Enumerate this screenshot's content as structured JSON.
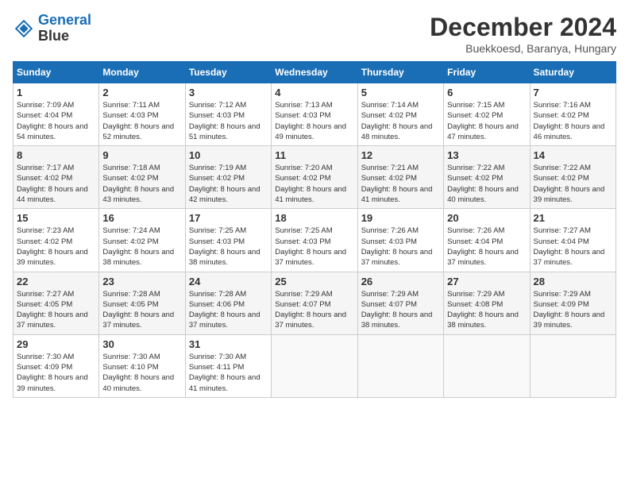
{
  "header": {
    "logo_line1": "General",
    "logo_line2": "Blue",
    "month_title": "December 2024",
    "location": "Buekkoesd, Baranya, Hungary"
  },
  "weekdays": [
    "Sunday",
    "Monday",
    "Tuesday",
    "Wednesday",
    "Thursday",
    "Friday",
    "Saturday"
  ],
  "weeks": [
    [
      {
        "day": "1",
        "sunrise": "Sunrise: 7:09 AM",
        "sunset": "Sunset: 4:04 PM",
        "daylight": "Daylight: 8 hours and 54 minutes."
      },
      {
        "day": "2",
        "sunrise": "Sunrise: 7:11 AM",
        "sunset": "Sunset: 4:03 PM",
        "daylight": "Daylight: 8 hours and 52 minutes."
      },
      {
        "day": "3",
        "sunrise": "Sunrise: 7:12 AM",
        "sunset": "Sunset: 4:03 PM",
        "daylight": "Daylight: 8 hours and 51 minutes."
      },
      {
        "day": "4",
        "sunrise": "Sunrise: 7:13 AM",
        "sunset": "Sunset: 4:03 PM",
        "daylight": "Daylight: 8 hours and 49 minutes."
      },
      {
        "day": "5",
        "sunrise": "Sunrise: 7:14 AM",
        "sunset": "Sunset: 4:02 PM",
        "daylight": "Daylight: 8 hours and 48 minutes."
      },
      {
        "day": "6",
        "sunrise": "Sunrise: 7:15 AM",
        "sunset": "Sunset: 4:02 PM",
        "daylight": "Daylight: 8 hours and 47 minutes."
      },
      {
        "day": "7",
        "sunrise": "Sunrise: 7:16 AM",
        "sunset": "Sunset: 4:02 PM",
        "daylight": "Daylight: 8 hours and 46 minutes."
      }
    ],
    [
      {
        "day": "8",
        "sunrise": "Sunrise: 7:17 AM",
        "sunset": "Sunset: 4:02 PM",
        "daylight": "Daylight: 8 hours and 44 minutes."
      },
      {
        "day": "9",
        "sunrise": "Sunrise: 7:18 AM",
        "sunset": "Sunset: 4:02 PM",
        "daylight": "Daylight: 8 hours and 43 minutes."
      },
      {
        "day": "10",
        "sunrise": "Sunrise: 7:19 AM",
        "sunset": "Sunset: 4:02 PM",
        "daylight": "Daylight: 8 hours and 42 minutes."
      },
      {
        "day": "11",
        "sunrise": "Sunrise: 7:20 AM",
        "sunset": "Sunset: 4:02 PM",
        "daylight": "Daylight: 8 hours and 41 minutes."
      },
      {
        "day": "12",
        "sunrise": "Sunrise: 7:21 AM",
        "sunset": "Sunset: 4:02 PM",
        "daylight": "Daylight: 8 hours and 41 minutes."
      },
      {
        "day": "13",
        "sunrise": "Sunrise: 7:22 AM",
        "sunset": "Sunset: 4:02 PM",
        "daylight": "Daylight: 8 hours and 40 minutes."
      },
      {
        "day": "14",
        "sunrise": "Sunrise: 7:22 AM",
        "sunset": "Sunset: 4:02 PM",
        "daylight": "Daylight: 8 hours and 39 minutes."
      }
    ],
    [
      {
        "day": "15",
        "sunrise": "Sunrise: 7:23 AM",
        "sunset": "Sunset: 4:02 PM",
        "daylight": "Daylight: 8 hours and 39 minutes."
      },
      {
        "day": "16",
        "sunrise": "Sunrise: 7:24 AM",
        "sunset": "Sunset: 4:02 PM",
        "daylight": "Daylight: 8 hours and 38 minutes."
      },
      {
        "day": "17",
        "sunrise": "Sunrise: 7:25 AM",
        "sunset": "Sunset: 4:03 PM",
        "daylight": "Daylight: 8 hours and 38 minutes."
      },
      {
        "day": "18",
        "sunrise": "Sunrise: 7:25 AM",
        "sunset": "Sunset: 4:03 PM",
        "daylight": "Daylight: 8 hours and 37 minutes."
      },
      {
        "day": "19",
        "sunrise": "Sunrise: 7:26 AM",
        "sunset": "Sunset: 4:03 PM",
        "daylight": "Daylight: 8 hours and 37 minutes."
      },
      {
        "day": "20",
        "sunrise": "Sunrise: 7:26 AM",
        "sunset": "Sunset: 4:04 PM",
        "daylight": "Daylight: 8 hours and 37 minutes."
      },
      {
        "day": "21",
        "sunrise": "Sunrise: 7:27 AM",
        "sunset": "Sunset: 4:04 PM",
        "daylight": "Daylight: 8 hours and 37 minutes."
      }
    ],
    [
      {
        "day": "22",
        "sunrise": "Sunrise: 7:27 AM",
        "sunset": "Sunset: 4:05 PM",
        "daylight": "Daylight: 8 hours and 37 minutes."
      },
      {
        "day": "23",
        "sunrise": "Sunrise: 7:28 AM",
        "sunset": "Sunset: 4:05 PM",
        "daylight": "Daylight: 8 hours and 37 minutes."
      },
      {
        "day": "24",
        "sunrise": "Sunrise: 7:28 AM",
        "sunset": "Sunset: 4:06 PM",
        "daylight": "Daylight: 8 hours and 37 minutes."
      },
      {
        "day": "25",
        "sunrise": "Sunrise: 7:29 AM",
        "sunset": "Sunset: 4:07 PM",
        "daylight": "Daylight: 8 hours and 37 minutes."
      },
      {
        "day": "26",
        "sunrise": "Sunrise: 7:29 AM",
        "sunset": "Sunset: 4:07 PM",
        "daylight": "Daylight: 8 hours and 38 minutes."
      },
      {
        "day": "27",
        "sunrise": "Sunrise: 7:29 AM",
        "sunset": "Sunset: 4:08 PM",
        "daylight": "Daylight: 8 hours and 38 minutes."
      },
      {
        "day": "28",
        "sunrise": "Sunrise: 7:29 AM",
        "sunset": "Sunset: 4:09 PM",
        "daylight": "Daylight: 8 hours and 39 minutes."
      }
    ],
    [
      {
        "day": "29",
        "sunrise": "Sunrise: 7:30 AM",
        "sunset": "Sunset: 4:09 PM",
        "daylight": "Daylight: 8 hours and 39 minutes."
      },
      {
        "day": "30",
        "sunrise": "Sunrise: 7:30 AM",
        "sunset": "Sunset: 4:10 PM",
        "daylight": "Daylight: 8 hours and 40 minutes."
      },
      {
        "day": "31",
        "sunrise": "Sunrise: 7:30 AM",
        "sunset": "Sunset: 4:11 PM",
        "daylight": "Daylight: 8 hours and 41 minutes."
      },
      null,
      null,
      null,
      null
    ]
  ]
}
